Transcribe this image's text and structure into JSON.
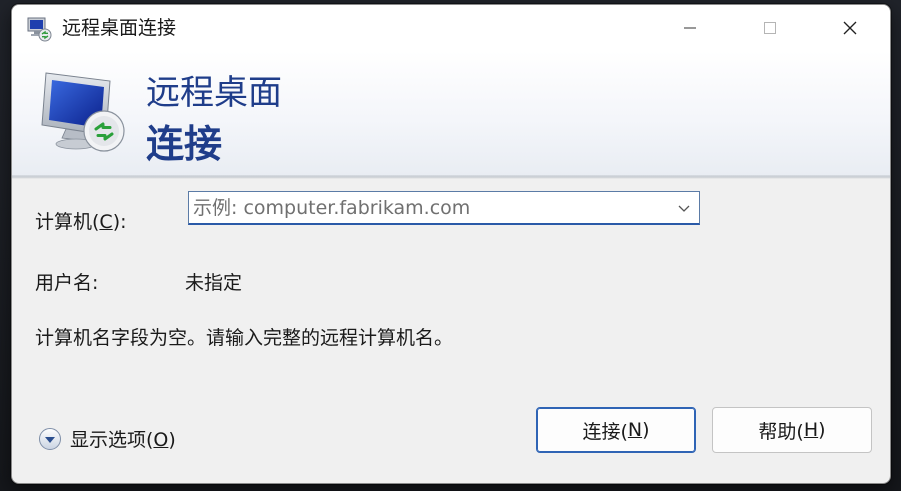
{
  "window": {
    "title": "远程桌面连接",
    "minimize_label": "—",
    "maximize_label": "☐",
    "close_label": "✕"
  },
  "banner": {
    "line1": "远程桌面",
    "line2": "连接"
  },
  "form": {
    "computer_label_prefix": "计算机(",
    "computer_label_key": "C",
    "computer_label_suffix": "):",
    "computer_placeholder": "示例: computer.fabrikam.com",
    "computer_value": "",
    "username_label": "用户名:",
    "username_value": "未指定",
    "message": "计算机名字段为空。请输入完整的远程计算机名。"
  },
  "footer": {
    "options_prefix": "显示选项(",
    "options_key": "O",
    "options_suffix": ")",
    "connect_prefix": "连接(",
    "connect_key": "N",
    "connect_suffix": ")",
    "help_prefix": "帮助(",
    "help_key": "H",
    "help_suffix": ")"
  },
  "icons": {
    "title": "remote-desktop-icon",
    "banner": "remote-desktop-monitor-icon",
    "options": "chevron-down-circle-icon",
    "combo": "chevron-down-icon"
  },
  "colors": {
    "accent": "#1f3d8a",
    "focus_border": "#2a5aa8",
    "dialog_bg": "#f0f0f0"
  }
}
